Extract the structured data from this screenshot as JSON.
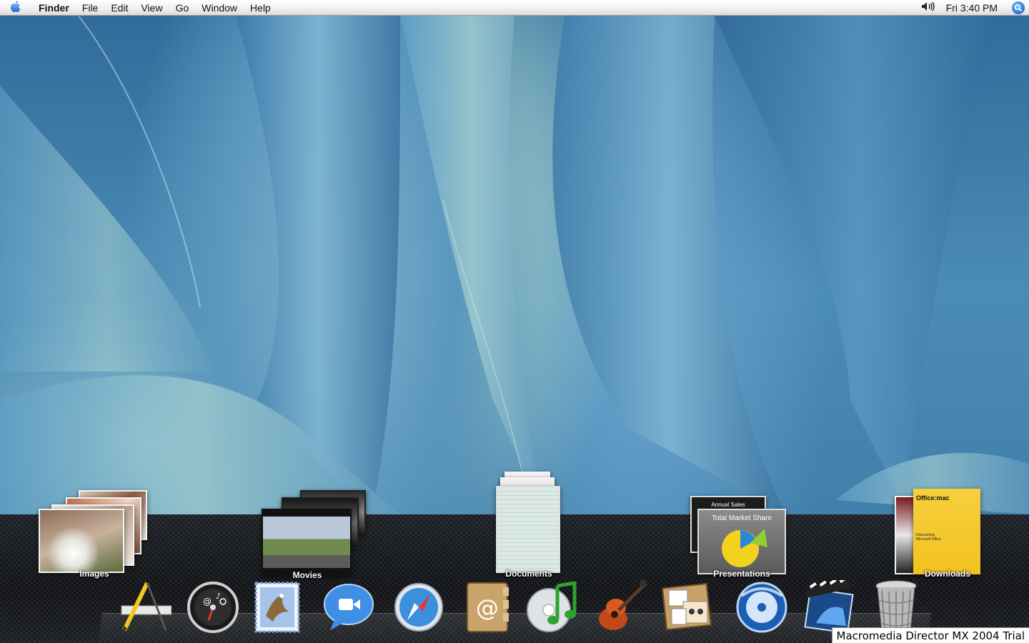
{
  "menubar": {
    "app_name": "Finder",
    "items": [
      "File",
      "Edit",
      "View",
      "Go",
      "Window",
      "Help"
    ],
    "clock": "Fri 3:40 PM",
    "icons": {
      "apple": "apple-icon",
      "volume": "volume-icon",
      "spotlight": "spotlight-icon"
    }
  },
  "stacks": [
    {
      "label": "Images"
    },
    {
      "label": "Movies"
    },
    {
      "label": "Documents"
    },
    {
      "label": "Presentations",
      "card_title_back": "Annual Sales",
      "card_title_front": "Total Market Share"
    },
    {
      "label": "Downloads",
      "card_title": "Office:mac",
      "card_subtitle": "Discovering Microsoft Office"
    }
  ],
  "dock_apps": [
    {
      "icon": "applications-icon"
    },
    {
      "icon": "dashboard-icon"
    },
    {
      "icon": "mail-icon"
    },
    {
      "icon": "ichat-icon"
    },
    {
      "icon": "safari-icon"
    },
    {
      "icon": "address-book-icon"
    },
    {
      "icon": "itunes-icon"
    },
    {
      "icon": "garageband-icon"
    },
    {
      "icon": "iphoto-icon"
    },
    {
      "icon": "dvd-player-icon"
    },
    {
      "icon": "imovie-icon"
    },
    {
      "icon": "trash-icon"
    }
  ],
  "trial_banner": "Macromedia Director MX 2004 Trial",
  "colors": {
    "accent_blue": "#1f73d8",
    "wallpaper_blue": "#4b8cb6"
  }
}
